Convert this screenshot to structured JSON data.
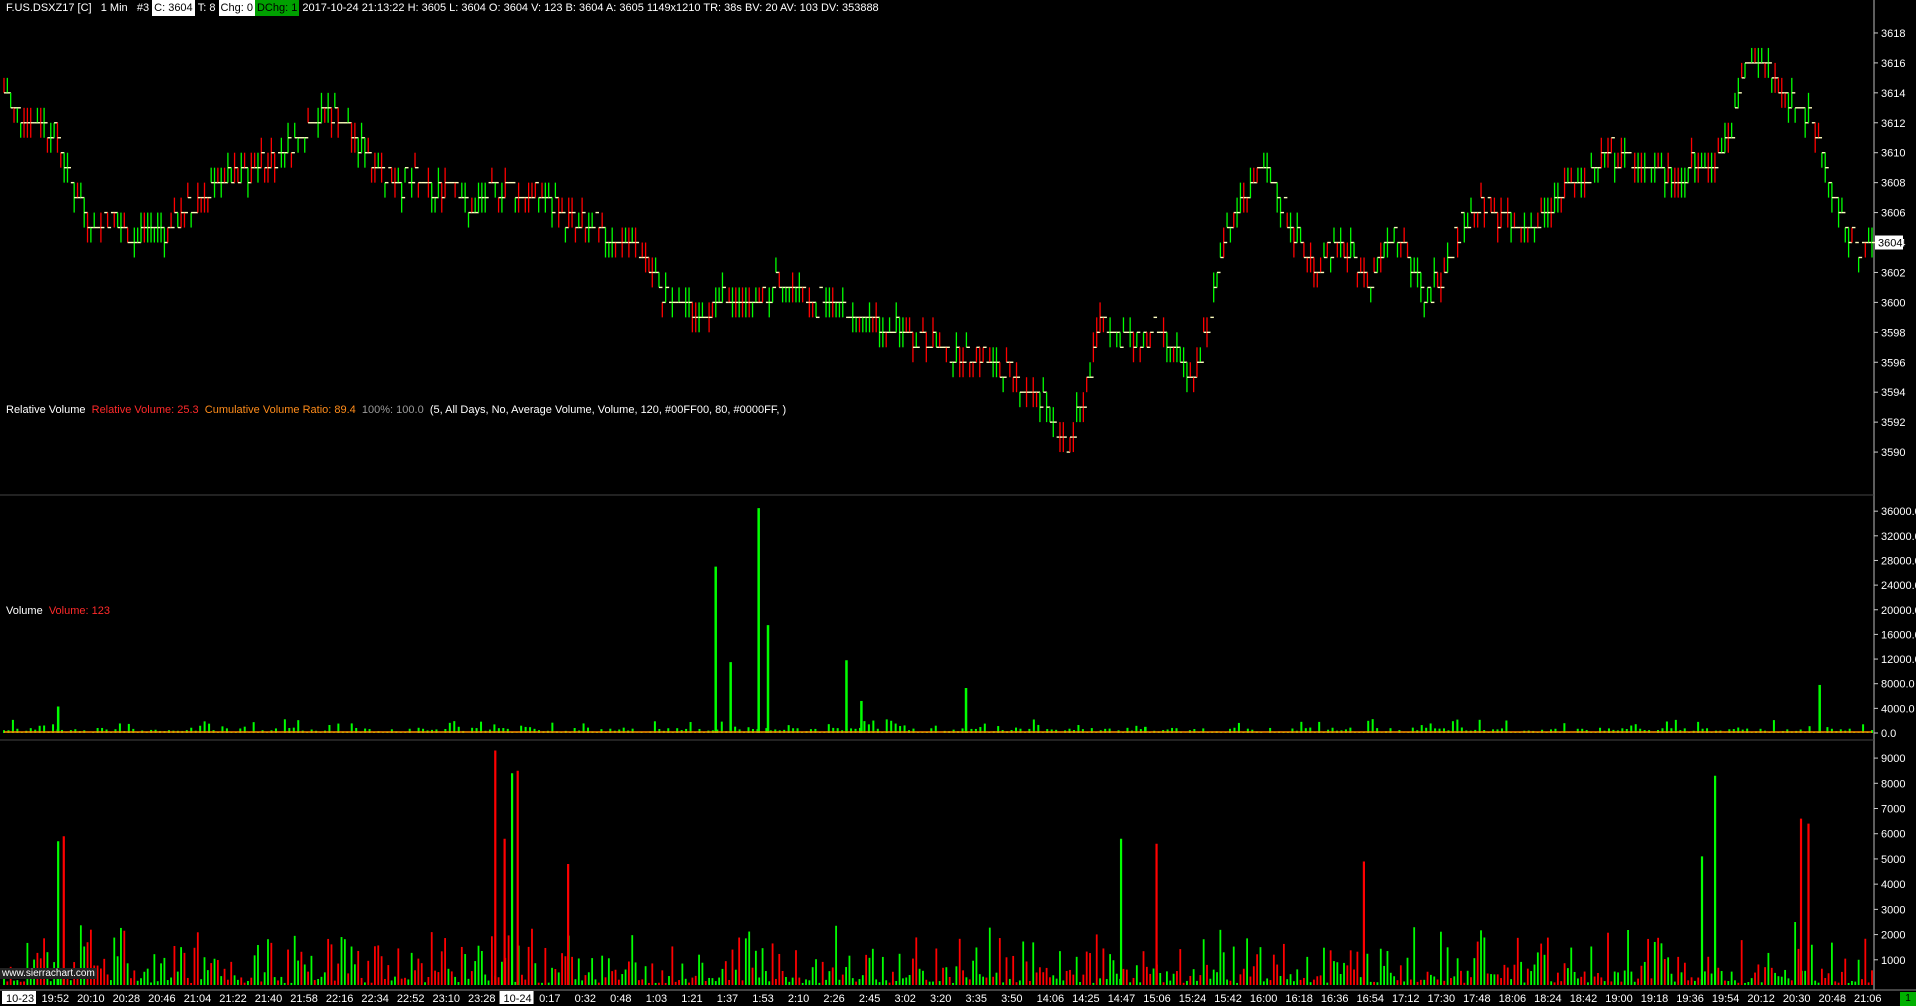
{
  "header": {
    "symbol": "F.US.DSXZ17 [C]",
    "interval": "1 Min",
    "chart_no": "#3",
    "close_box": "C: 3604",
    "trades": "T: 8",
    "chg_box": "Chg: 0",
    "dchg_box": "DChg: 1",
    "details": "2017-10-24 21:13:22 H: 3605 L: 3604 O: 3604 V: 123 B: 3604 A: 3605 1149x1210 TR: 38s BV: 20 AV: 103 DV: 353888"
  },
  "relvol_header": {
    "name": "Relative Volume",
    "relvol": "Relative Volume: 25.3",
    "cumratio": "Cumulative Volume Ratio: 89.4",
    "pct": "100%: 100.0",
    "params": "(5, All Days, No, Average Volume, Volume, 120, #00FF00, 80, #0000FF, )"
  },
  "volume_header": {
    "name": "Volume",
    "value": "Volume: 123"
  },
  "watermark": "www.sierrachart.com",
  "corner_badge": "1",
  "colors": {
    "up": "#00ff00",
    "down": "#ff0000",
    "line": "#ff8c00",
    "axis": "#ffffff",
    "bg": "#000000"
  },
  "chart_data": [
    {
      "type": "line",
      "name": "price-ohlc",
      "ylim": [
        3588,
        3619
      ],
      "y_ticks": [
        "3618",
        "3616",
        "3614",
        "3612",
        "3610",
        "3608",
        "3606",
        "3604",
        "3602",
        "3600",
        "3598",
        "3596",
        "3594",
        "3592",
        "3590"
      ],
      "last_price_label": "3604",
      "x_labels": [
        "10-23",
        "19:52",
        "20:10",
        "20:28",
        "20:46",
        "21:04",
        "21:22",
        "21:40",
        "21:58",
        "22:16",
        "22:34",
        "22:52",
        "23:10",
        "23:28",
        "10-24",
        "0:17",
        "0:32",
        "0:48",
        "1:03",
        "1:21",
        "1:37",
        "1:53",
        "2:10",
        "2:26",
        "2:45",
        "3:02",
        "3:20",
        "3:35",
        "3:50",
        "14:06",
        "14:25",
        "14:47",
        "15:06",
        "15:24",
        "15:42",
        "16:00",
        "16:18",
        "16:36",
        "16:54",
        "17:12",
        "17:30",
        "17:48",
        "18:06",
        "18:24",
        "18:42",
        "19:00",
        "19:18",
        "19:36",
        "19:54",
        "20:12",
        "20:30",
        "20:48",
        "21:06"
      ],
      "close_path": [
        3614,
        3612,
        3612,
        3611,
        3607,
        3605,
        3606,
        3604,
        3605,
        3605,
        3606,
        3607,
        3608,
        3608,
        3609,
        3610,
        3611,
        3612,
        3613,
        3612,
        3610,
        3609,
        3608,
        3608,
        3607,
        3608,
        3606,
        3607,
        3608,
        3607,
        3607,
        3606,
        3605,
        3605,
        3604,
        3604,
        3602,
        3600,
        3600,
        3599,
        3600,
        3600,
        3600,
        3601,
        3601,
        3600,
        3600,
        3599,
        3599,
        3598,
        3598,
        3598,
        3597,
        3596,
        3597,
        3596,
        3595,
        3594,
        3593,
        3590,
        3593,
        3599,
        3598,
        3597,
        3598,
        3597,
        3595,
        3598,
        3605,
        3607,
        3609,
        3607,
        3604,
        3602,
        3604,
        3603,
        3601,
        3605,
        3604,
        3600,
        3602,
        3605,
        3606,
        3606,
        3605,
        3605,
        3606,
        3608,
        3608,
        3610,
        3610,
        3609,
        3609,
        3608,
        3609,
        3609,
        3611,
        3616,
        3616,
        3614,
        3613,
        3611,
        3606,
        3604,
        3604
      ],
      "y_unit_min": 3590
    },
    {
      "type": "bar",
      "name": "relative-volume",
      "ylim": [
        0,
        37000
      ],
      "y_ticks": [
        "36000.0",
        "32000.0",
        "28000.0",
        "24000.0",
        "20000.0",
        "16000.0",
        "12000.0",
        "8000.0",
        "4000.0",
        "0.0"
      ],
      "spikes": [
        {
          "pos": 0.029,
          "value": 4300
        },
        {
          "pos": 0.381,
          "value": 27000
        },
        {
          "pos": 0.389,
          "value": 11500
        },
        {
          "pos": 0.404,
          "value": 36500
        },
        {
          "pos": 0.409,
          "value": 17500
        },
        {
          "pos": 0.451,
          "value": 11800
        },
        {
          "pos": 0.459,
          "value": 5200
        },
        {
          "pos": 0.515,
          "value": 7300
        },
        {
          "pos": 0.972,
          "value": 7800
        },
        {
          "pos": 0.611,
          "value": 1000
        }
      ],
      "baseline_line_value": 0
    },
    {
      "type": "bar",
      "name": "volume",
      "ylim": [
        0,
        9400
      ],
      "y_ticks": [
        "9000",
        "8000",
        "7000",
        "6000",
        "5000",
        "4000",
        "3000",
        "2000",
        "1000"
      ],
      "spikes": [
        {
          "pos": 0.029,
          "value": 5700,
          "dir": "up"
        },
        {
          "pos": 0.032,
          "value": 5900,
          "dir": "down"
        },
        {
          "pos": 0.263,
          "value": 9300,
          "dir": "down"
        },
        {
          "pos": 0.268,
          "value": 5800,
          "dir": "down"
        },
        {
          "pos": 0.272,
          "value": 8400,
          "dir": "up"
        },
        {
          "pos": 0.275,
          "value": 8500,
          "dir": "down"
        },
        {
          "pos": 0.302,
          "value": 4800,
          "dir": "down"
        },
        {
          "pos": 0.598,
          "value": 5800,
          "dir": "up"
        },
        {
          "pos": 0.617,
          "value": 5600,
          "dir": "down"
        },
        {
          "pos": 0.728,
          "value": 4900,
          "dir": "down"
        },
        {
          "pos": 0.909,
          "value": 5100,
          "dir": "up"
        },
        {
          "pos": 0.916,
          "value": 8300,
          "dir": "up"
        },
        {
          "pos": 0.962,
          "value": 6600,
          "dir": "down"
        },
        {
          "pos": 0.966,
          "value": 6400,
          "dir": "down"
        }
      ]
    }
  ]
}
